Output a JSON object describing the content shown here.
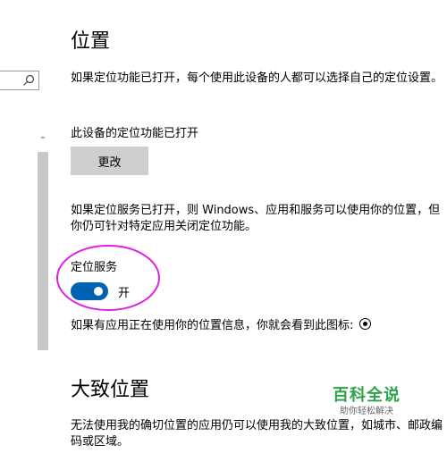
{
  "page": {
    "title": "位置",
    "intro": "如果定位功能已打开，每个使用此设备的人都可以选择自己的定位设置。",
    "device_status": "此设备的定位功能已打开",
    "change_button": "更改",
    "service_desc": "如果定位服务已打开，则 Windows、应用和服务可以使用你的位置，但你仍可针对特定应用关闭定位功能。",
    "service_label": "定位服务",
    "toggle_state": "开",
    "icon_note": "如果有应用正在使用你的位置信息，你就会看到此图标:",
    "approx_title": "大致位置",
    "approx_desc": "无法使用我的确切位置的应用仍可以使用我的大致位置，如城市、邮政编码或区域。"
  },
  "watermark": {
    "title": "百科全说",
    "subtitle": "助你轻松解决"
  },
  "colors": {
    "accent": "#0063b1",
    "highlight": "#e020e0",
    "watermark": "#2aa34a"
  }
}
